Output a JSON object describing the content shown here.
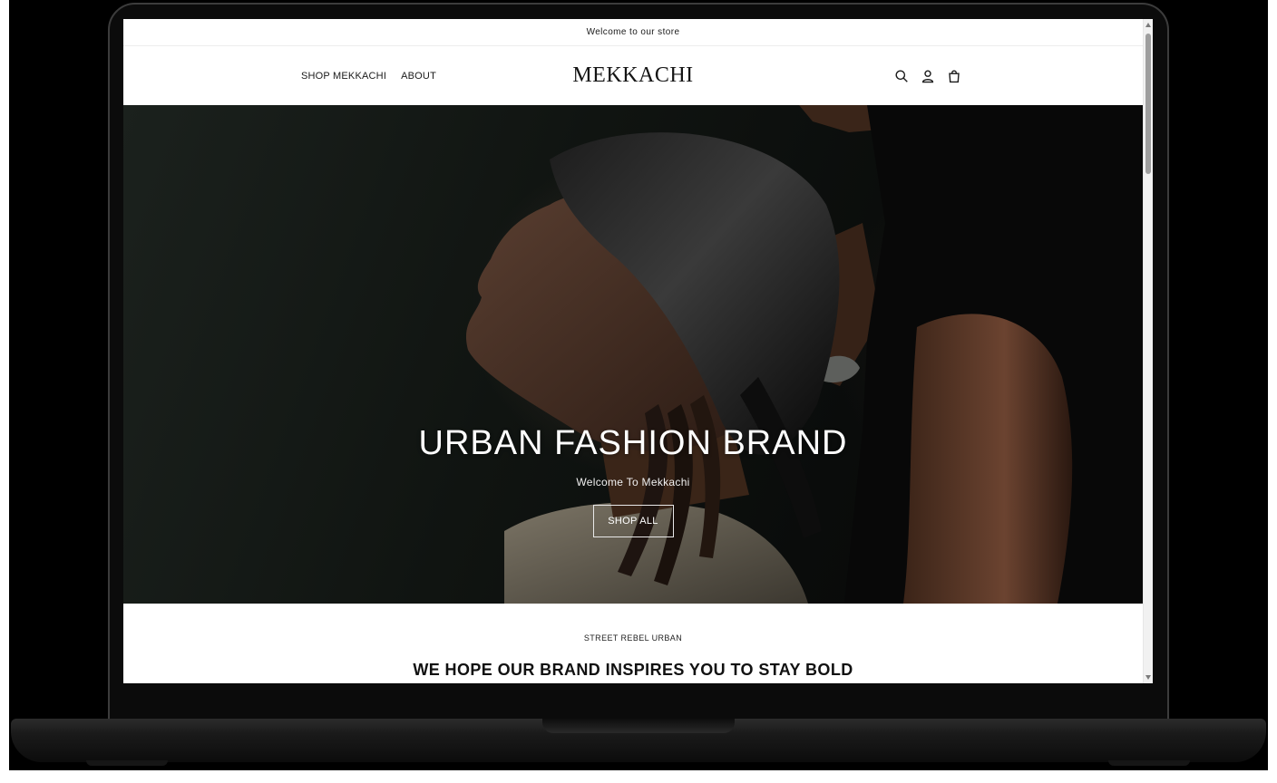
{
  "announcement": {
    "text": "Welcome to our store"
  },
  "header": {
    "nav": [
      {
        "label": "SHOP MEKKACHI"
      },
      {
        "label": "ABOUT"
      }
    ],
    "logo": "MEKKACHI",
    "icons": [
      "search-icon",
      "account-icon",
      "cart-icon"
    ]
  },
  "hero": {
    "title": "URBAN FASHION BRAND",
    "subtitle": "Welcome To Mekkachi",
    "cta_label": "SHOP ALL"
  },
  "intro": {
    "eyebrow": "STREET REBEL URBAN",
    "heading": "WE HOPE OUR BRAND INSPIRES YOU TO STAY BOLD"
  },
  "colors": {
    "page_background": "#ffffff",
    "text": "#1a1a1a",
    "hero_text": "#ffffff",
    "laptop_frame": "#0b0b0b"
  }
}
